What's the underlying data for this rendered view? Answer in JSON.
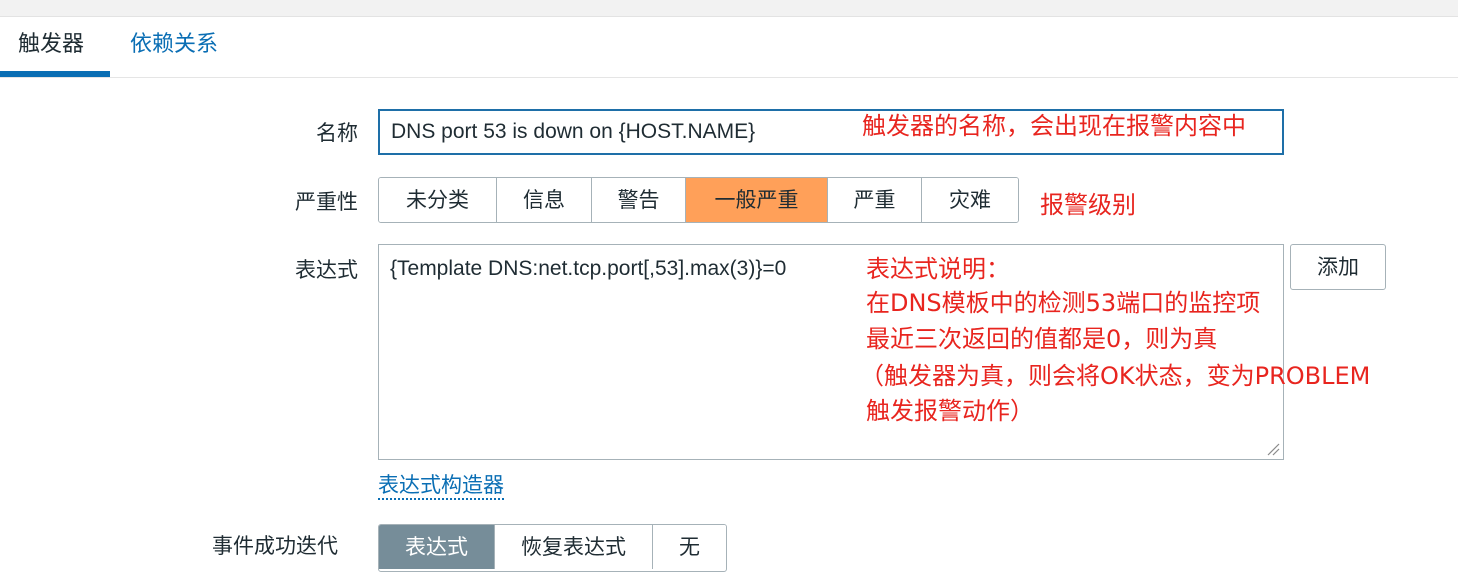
{
  "tabs": [
    {
      "label": "触发器",
      "active": true
    },
    {
      "label": "依赖关系",
      "active": false
    }
  ],
  "form": {
    "name_label": "名称",
    "name_value": "DNS port 53 is down on {HOST.NAME}",
    "severity_label": "严重性",
    "severity_options": [
      "未分类",
      "信息",
      "警告",
      "一般严重",
      "严重",
      "灾难"
    ],
    "severity_selected": "一般严重",
    "expression_label": "表达式",
    "expression_value": "{Template DNS:net.tcp.port[,53].max(3)}=0",
    "add_button": "添加",
    "builder_link": "表达式构造器",
    "bottom_label": "事件成功迭代",
    "bottom_options": [
      "表达式",
      "恢复表达式",
      "无"
    ]
  },
  "annotations": {
    "name_note": "触发器的名称，会出现在报警内容中",
    "severity_note": "报警级别",
    "expr_note_lines": [
      "表达式说明：",
      "在DNS模板中的检测53端口的监控项",
      "最近三次返回的值都是0，则为真",
      "（触发器为真，则会将OK状态，变为PROBLEM",
      "触发报警动作）"
    ]
  },
  "colors": {
    "link": "#0a6eb4",
    "selected_severity": "#ffa059",
    "annotation": "#e8251f",
    "input_focus_border": "#1e6fa8"
  }
}
